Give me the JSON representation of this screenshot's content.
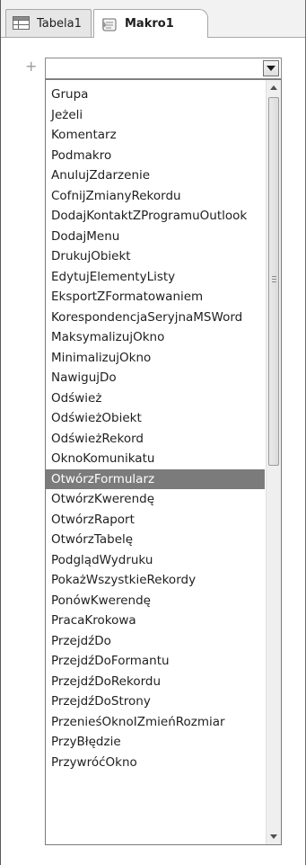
{
  "tabs": [
    {
      "label": "Tabela1",
      "icon": "table-icon"
    },
    {
      "label": "Makro1",
      "icon": "macro-icon"
    }
  ],
  "macro_action": {
    "combo_value": "",
    "add_icon": "plus-icon",
    "actions": [
      "Grupa",
      "Jeżeli",
      "Komentarz",
      "Podmakro",
      "AnulujZdarzenie",
      "CofnijZmianyRekordu",
      "DodajKontaktZProgramuOutlook",
      "DodajMenu",
      "DrukujObiekt",
      "EdytujElementyListy",
      "EksportZFormatowaniem",
      "KorespondencjaSeryjnaMSWord",
      "MaksymalizujOkno",
      "MinimalizujOkno",
      "NawigujDo",
      "Odśwież",
      "OdświeżObiekt",
      "OdświeżRekord",
      "OknoKomunikatu",
      "OtwórzFormularz",
      "OtwórzKwerendę",
      "OtwórzRaport",
      "OtwórzTabelę",
      "PodglądWydruku",
      "PokażWszystkieRekordy",
      "PonówKwerendę",
      "PracaKrokowa",
      "PrzejdźDo",
      "PrzejdźDoFormantu",
      "PrzejdźDoRekordu",
      "PrzejdźDoStrony",
      "PrzenieśOknoIZmieńRozmiar",
      "PrzyBłędzie",
      "PrzywróćOkno"
    ],
    "selected_action": "OtwórzFormularz"
  },
  "colors": {
    "selection": "#7b7b7b",
    "tab_bar": "#f2f2f2"
  }
}
